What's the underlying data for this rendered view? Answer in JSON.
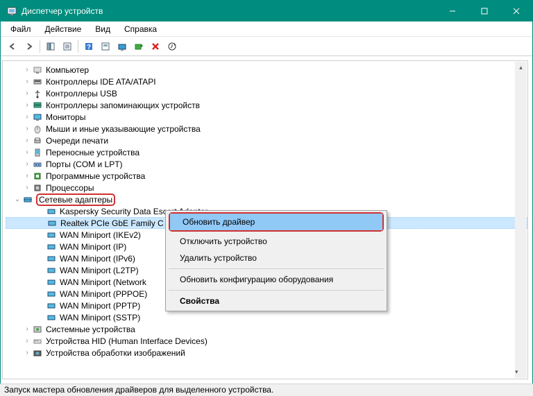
{
  "title": "Диспетчер устройств",
  "menu": {
    "file": "Файл",
    "action": "Действие",
    "view": "Вид",
    "help": "Справка"
  },
  "tree": {
    "items": [
      "Компьютер",
      "Контроллеры IDE ATA/ATAPI",
      "Контроллеры USB",
      "Контроллеры запоминающих устройств",
      "Мониторы",
      "Мыши и иные указывающие устройства",
      "Очереди печати",
      "Переносные устройства",
      "Порты (COM и LPT)",
      "Программные устройства",
      "Процессоры"
    ],
    "expanded": {
      "label": "Сетевые адаптеры",
      "children": [
        "Kaspersky Security Data Escort Adapter",
        "Realtek PCIe GbE Family C",
        "WAN Miniport (IKEv2)",
        "WAN Miniport (IP)",
        "WAN Miniport (IPv6)",
        "WAN Miniport (L2TP)",
        "WAN Miniport (Network",
        "WAN Miniport (PPPOE)",
        "WAN Miniport (PPTP)",
        "WAN Miniport (SSTP)"
      ]
    },
    "after": [
      "Системные устройства",
      "Устройства HID (Human Interface Devices)",
      "Устройства обработки изображений"
    ]
  },
  "ctx": {
    "update": "Обновить драйвер",
    "disable": "Отключить устройство",
    "delete": "Удалить устройство",
    "scan": "Обновить конфигурацию оборудования",
    "props": "Свойства"
  },
  "status": "Запуск мастера обновления драйверов для выделенного устройства."
}
